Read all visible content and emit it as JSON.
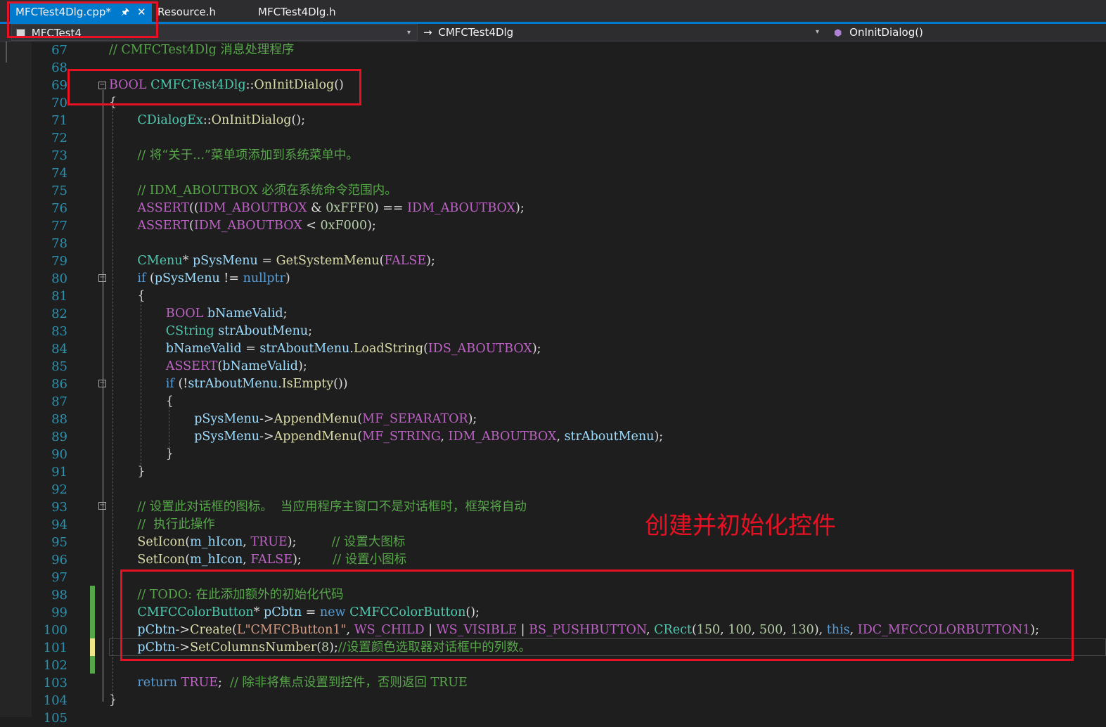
{
  "tabs": [
    {
      "label": "MFCTest4Dlg.cpp*",
      "active": true,
      "pinned": true
    },
    {
      "label": "Resource.h"
    },
    {
      "label": "MFCTest4Dlg.h"
    }
  ],
  "nav": {
    "project": "MFCTest4",
    "scope": "CMFCTest4Dlg",
    "member": "OnInitDialog()"
  },
  "annotation": "创建并初始化控件",
  "code_lines": [
    {
      "n": 67,
      "indent": 0,
      "tokens": [
        [
          "cm",
          "// CMFCTest4Dlg 消息处理程序"
        ]
      ]
    },
    {
      "n": 68,
      "indent": 0,
      "tokens": []
    },
    {
      "n": 69,
      "indent": 0,
      "tokens": [
        [
          "mac",
          "BOOL"
        ],
        [
          "pl",
          " "
        ],
        [
          "ty",
          "CMFCTest4Dlg"
        ],
        [
          "pl",
          "::"
        ],
        [
          "fn",
          "OnInitDialog"
        ],
        [
          "pl",
          "()"
        ]
      ]
    },
    {
      "n": 70,
      "indent": 0,
      "tokens": [
        [
          "pl",
          "{"
        ]
      ]
    },
    {
      "n": 71,
      "indent": 4,
      "tokens": [
        [
          "ty",
          "CDialogEx"
        ],
        [
          "pl",
          "::"
        ],
        [
          "fn",
          "OnInitDialog"
        ],
        [
          "pl",
          "();"
        ]
      ]
    },
    {
      "n": 72,
      "indent": 0,
      "tokens": []
    },
    {
      "n": 73,
      "indent": 4,
      "tokens": [
        [
          "cm",
          "// 将“关于...”菜单项添加到系统菜单中。"
        ]
      ]
    },
    {
      "n": 74,
      "indent": 0,
      "tokens": []
    },
    {
      "n": 75,
      "indent": 4,
      "tokens": [
        [
          "cm",
          "// IDM_ABOUTBOX 必须在系统命令范围内。"
        ]
      ]
    },
    {
      "n": 76,
      "indent": 4,
      "tokens": [
        [
          "mac",
          "ASSERT"
        ],
        [
          "pl",
          "(("
        ],
        [
          "mac",
          "IDM_ABOUTBOX"
        ],
        [
          "pl",
          " & "
        ],
        [
          "num",
          "0xFFF0"
        ],
        [
          "pl",
          ") == "
        ],
        [
          "mac",
          "IDM_ABOUTBOX"
        ],
        [
          "pl",
          ");"
        ]
      ]
    },
    {
      "n": 77,
      "indent": 4,
      "tokens": [
        [
          "mac",
          "ASSERT"
        ],
        [
          "pl",
          "("
        ],
        [
          "mac",
          "IDM_ABOUTBOX"
        ],
        [
          "pl",
          " < "
        ],
        [
          "num",
          "0xF000"
        ],
        [
          "pl",
          ");"
        ]
      ]
    },
    {
      "n": 78,
      "indent": 0,
      "tokens": []
    },
    {
      "n": 79,
      "indent": 4,
      "tokens": [
        [
          "ty",
          "CMenu"
        ],
        [
          "pl",
          "* "
        ],
        [
          "var",
          "pSysMenu"
        ],
        [
          "pl",
          " = "
        ],
        [
          "fn",
          "GetSystemMenu"
        ],
        [
          "pl",
          "("
        ],
        [
          "mac",
          "FALSE"
        ],
        [
          "pl",
          ");"
        ]
      ]
    },
    {
      "n": 80,
      "indent": 4,
      "tokens": [
        [
          "kw",
          "if"
        ],
        [
          "pl",
          " ("
        ],
        [
          "var",
          "pSysMenu"
        ],
        [
          "pl",
          " != "
        ],
        [
          "kw",
          "nullptr"
        ],
        [
          "pl",
          ")"
        ]
      ]
    },
    {
      "n": 81,
      "indent": 4,
      "tokens": [
        [
          "pl",
          "{"
        ]
      ]
    },
    {
      "n": 82,
      "indent": 8,
      "tokens": [
        [
          "mac",
          "BOOL"
        ],
        [
          "pl",
          " "
        ],
        [
          "var",
          "bNameValid"
        ],
        [
          "pl",
          ";"
        ]
      ]
    },
    {
      "n": 83,
      "indent": 8,
      "tokens": [
        [
          "ty",
          "CString"
        ],
        [
          "pl",
          " "
        ],
        [
          "var",
          "strAboutMenu"
        ],
        [
          "pl",
          ";"
        ]
      ]
    },
    {
      "n": 84,
      "indent": 8,
      "tokens": [
        [
          "var",
          "bNameValid"
        ],
        [
          "pl",
          " = "
        ],
        [
          "var",
          "strAboutMenu"
        ],
        [
          "pl",
          "."
        ],
        [
          "fn",
          "LoadString"
        ],
        [
          "pl",
          "("
        ],
        [
          "mac",
          "IDS_ABOUTBOX"
        ],
        [
          "pl",
          ");"
        ]
      ]
    },
    {
      "n": 85,
      "indent": 8,
      "tokens": [
        [
          "mac",
          "ASSERT"
        ],
        [
          "pl",
          "("
        ],
        [
          "var",
          "bNameValid"
        ],
        [
          "pl",
          ");"
        ]
      ]
    },
    {
      "n": 86,
      "indent": 8,
      "tokens": [
        [
          "kw",
          "if"
        ],
        [
          "pl",
          " (!"
        ],
        [
          "var",
          "strAboutMenu"
        ],
        [
          "pl",
          "."
        ],
        [
          "fn",
          "IsEmpty"
        ],
        [
          "pl",
          "())"
        ]
      ]
    },
    {
      "n": 87,
      "indent": 8,
      "tokens": [
        [
          "pl",
          "{"
        ]
      ]
    },
    {
      "n": 88,
      "indent": 12,
      "tokens": [
        [
          "var",
          "pSysMenu"
        ],
        [
          "pl",
          "->"
        ],
        [
          "fn",
          "AppendMenu"
        ],
        [
          "pl",
          "("
        ],
        [
          "mac",
          "MF_SEPARATOR"
        ],
        [
          "pl",
          ");"
        ]
      ]
    },
    {
      "n": 89,
      "indent": 12,
      "tokens": [
        [
          "var",
          "pSysMenu"
        ],
        [
          "pl",
          "->"
        ],
        [
          "fn",
          "AppendMenu"
        ],
        [
          "pl",
          "("
        ],
        [
          "mac",
          "MF_STRING"
        ],
        [
          "pl",
          ", "
        ],
        [
          "mac",
          "IDM_ABOUTBOX"
        ],
        [
          "pl",
          ", "
        ],
        [
          "var",
          "strAboutMenu"
        ],
        [
          "pl",
          ");"
        ]
      ]
    },
    {
      "n": 90,
      "indent": 8,
      "tokens": [
        [
          "pl",
          "}"
        ]
      ]
    },
    {
      "n": 91,
      "indent": 4,
      "tokens": [
        [
          "pl",
          "}"
        ]
      ]
    },
    {
      "n": 92,
      "indent": 0,
      "tokens": []
    },
    {
      "n": 93,
      "indent": 4,
      "tokens": [
        [
          "cm",
          "// 设置此对话框的图标。  当应用程序主窗口不是对话框时，框架将自动"
        ]
      ]
    },
    {
      "n": 94,
      "indent": 4,
      "tokens": [
        [
          "cm",
          "//  执行此操作"
        ]
      ]
    },
    {
      "n": 95,
      "indent": 4,
      "tokens": [
        [
          "fn",
          "SetIcon"
        ],
        [
          "pl",
          "("
        ],
        [
          "var",
          "m_hIcon"
        ],
        [
          "pl",
          ", "
        ],
        [
          "mac",
          "TRUE"
        ],
        [
          "pl",
          ");         "
        ],
        [
          "cm",
          "// 设置大图标"
        ]
      ]
    },
    {
      "n": 96,
      "indent": 4,
      "tokens": [
        [
          "fn",
          "SetIcon"
        ],
        [
          "pl",
          "("
        ],
        [
          "var",
          "m_hIcon"
        ],
        [
          "pl",
          ", "
        ],
        [
          "mac",
          "FALSE"
        ],
        [
          "pl",
          ");        "
        ],
        [
          "cm",
          "// 设置小图标"
        ]
      ]
    },
    {
      "n": 97,
      "indent": 0,
      "tokens": []
    },
    {
      "n": 98,
      "indent": 4,
      "tokens": [
        [
          "cm",
          "// TODO: 在此添加额外的初始化代码"
        ]
      ]
    },
    {
      "n": 99,
      "indent": 4,
      "tokens": [
        [
          "ty",
          "CMFCColorButton"
        ],
        [
          "pl",
          "* "
        ],
        [
          "var",
          "pCbtn"
        ],
        [
          "pl",
          " = "
        ],
        [
          "kw",
          "new"
        ],
        [
          "pl",
          " "
        ],
        [
          "ty",
          "CMFCColorButton"
        ],
        [
          "pl",
          "();"
        ]
      ]
    },
    {
      "n": 100,
      "indent": 4,
      "tokens": [
        [
          "var",
          "pCbtn"
        ],
        [
          "pl",
          "->"
        ],
        [
          "fn",
          "Create"
        ],
        [
          "pl",
          "("
        ],
        [
          "str",
          "L\"CMFCButton1\""
        ],
        [
          "pl",
          ", "
        ],
        [
          "mac",
          "WS_CHILD"
        ],
        [
          "pl",
          " | "
        ],
        [
          "mac",
          "WS_VISIBLE"
        ],
        [
          "pl",
          " | "
        ],
        [
          "mac",
          "BS_PUSHBUTTON"
        ],
        [
          "pl",
          ", "
        ],
        [
          "ty",
          "CRect"
        ],
        [
          "pl",
          "("
        ],
        [
          "num",
          "150"
        ],
        [
          "pl",
          ", "
        ],
        [
          "num",
          "100"
        ],
        [
          "pl",
          ", "
        ],
        [
          "num",
          "500"
        ],
        [
          "pl",
          ", "
        ],
        [
          "num",
          "130"
        ],
        [
          "pl",
          "), "
        ],
        [
          "kw",
          "this"
        ],
        [
          "pl",
          ", "
        ],
        [
          "mac",
          "IDC_MFCCOLORBUTTON1"
        ],
        [
          "pl",
          ");"
        ]
      ]
    },
    {
      "n": 101,
      "indent": 4,
      "tokens": [
        [
          "var",
          "pCbtn"
        ],
        [
          "pl",
          "->"
        ],
        [
          "fn",
          "SetColumnsNumber"
        ],
        [
          "pl",
          "("
        ],
        [
          "num",
          "8"
        ],
        [
          "pl",
          ");"
        ],
        [
          "cm",
          "//设置颜色选取器对话框中的列数。"
        ]
      ]
    },
    {
      "n": 102,
      "indent": 0,
      "tokens": []
    },
    {
      "n": 103,
      "indent": 4,
      "tokens": [
        [
          "kw",
          "return"
        ],
        [
          "pl",
          " "
        ],
        [
          "mac",
          "TRUE"
        ],
        [
          "pl",
          ";  "
        ],
        [
          "cm",
          "// 除非将焦点设置到控件，否则返回 TRUE"
        ]
      ]
    },
    {
      "n": 104,
      "indent": 0,
      "tokens": [
        [
          "pl",
          "}"
        ]
      ]
    },
    {
      "n": 105,
      "indent": 0,
      "tokens": []
    }
  ],
  "colors": {
    "background": "#1e1e1e",
    "accent": "#007acc",
    "line_number": "#2b91af",
    "annotation_red": "#e81123"
  }
}
